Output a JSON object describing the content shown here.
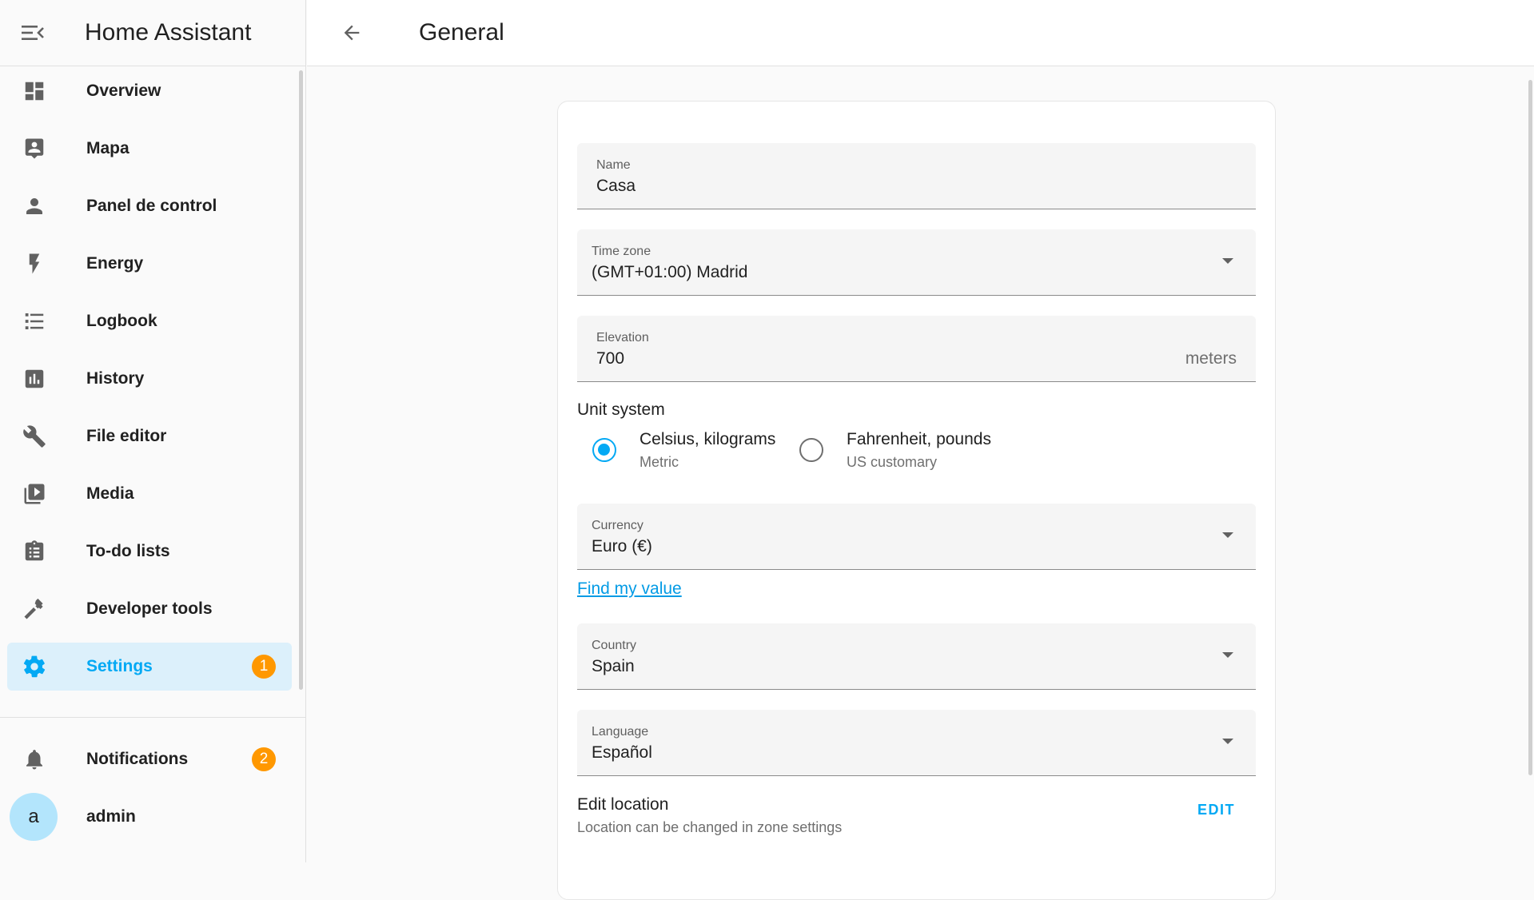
{
  "app": {
    "title": "Home Assistant"
  },
  "sidebar": {
    "items": [
      {
        "label": "Overview",
        "icon": "dashboard-icon"
      },
      {
        "label": "Mapa",
        "icon": "account-box-icon"
      },
      {
        "label": "Panel de control",
        "icon": "person-icon"
      },
      {
        "label": "Energy",
        "icon": "lightning-icon"
      },
      {
        "label": "Logbook",
        "icon": "list-icon"
      },
      {
        "label": "History",
        "icon": "chart-box-icon"
      },
      {
        "label": "File editor",
        "icon": "wrench-icon"
      },
      {
        "label": "Media",
        "icon": "play-box-icon"
      },
      {
        "label": "To-do lists",
        "icon": "clipboard-list-icon"
      },
      {
        "label": "Developer tools",
        "icon": "hammer-icon"
      },
      {
        "label": "Settings",
        "icon": "gear-icon",
        "badge": "1",
        "active": true
      }
    ],
    "notifications": {
      "label": "Notifications",
      "badge": "2"
    },
    "user": {
      "label": "admin",
      "avatar_letter": "a"
    }
  },
  "header": {
    "title": "General"
  },
  "form": {
    "name": {
      "label": "Name",
      "value": "Casa"
    },
    "time_zone": {
      "label": "Time zone",
      "value": "(GMT+01:00) Madrid"
    },
    "elevation": {
      "label": "Elevation",
      "value": "700",
      "suffix": "meters"
    },
    "unit_system": {
      "title": "Unit system",
      "options": [
        {
          "label": "Celsius, kilograms",
          "sub": "Metric",
          "selected": true
        },
        {
          "label": "Fahrenheit, pounds",
          "sub": "US customary",
          "selected": false
        }
      ]
    },
    "currency": {
      "label": "Currency",
      "value": "Euro (€)"
    },
    "find_value_link": "Find my value",
    "country": {
      "label": "Country",
      "value": "Spain"
    },
    "language": {
      "label": "Language",
      "value": "Español"
    },
    "edit_location": {
      "title": "Edit location",
      "sub": "Location can be changed in zone settings",
      "button": "EDIT"
    }
  },
  "colors": {
    "accent": "#03a9f4",
    "badge": "#ff9800",
    "active_bg": "#dcf0fb"
  }
}
